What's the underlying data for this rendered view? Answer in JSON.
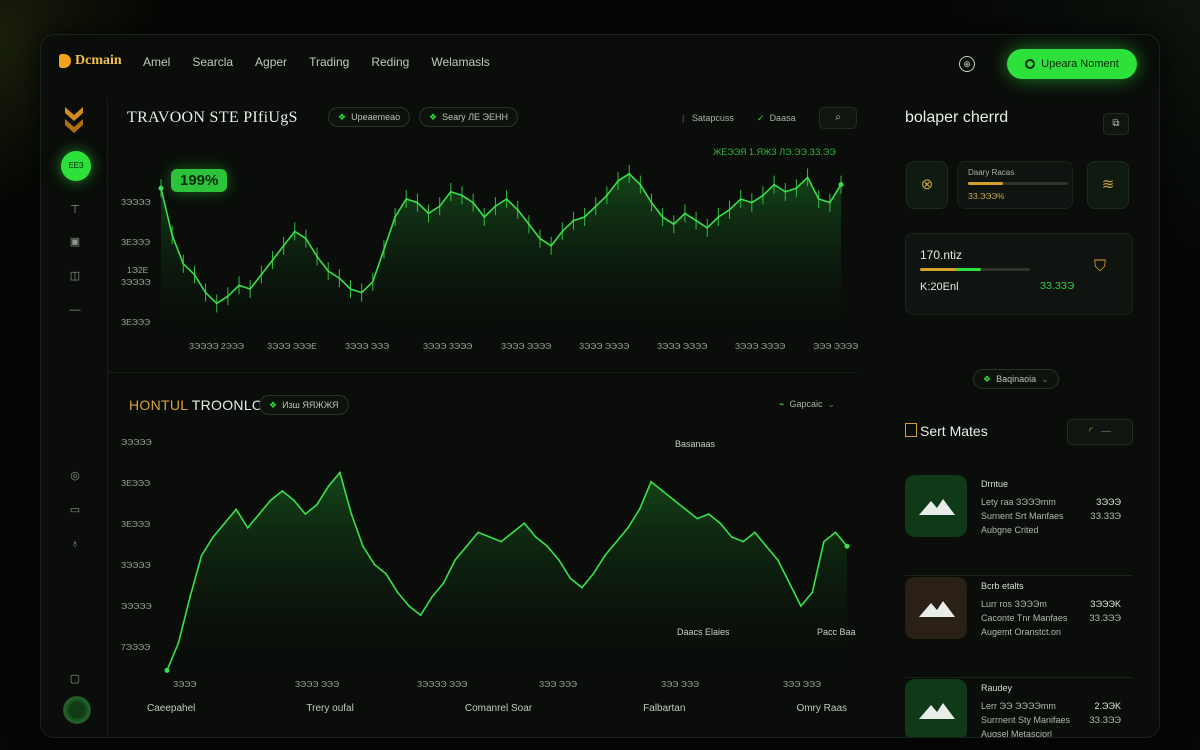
{
  "app": {
    "logo_text": "Dcmain",
    "nav": [
      "Amel",
      "Searcla",
      "Agper",
      "Trading",
      "Reding",
      "Welamasls"
    ],
    "upgrade_label": "Upeara Noment"
  },
  "sidebar": {
    "active_label": "ЕЕЗ"
  },
  "chart1": {
    "title": "TRAVOON STE PIfiUgS",
    "pill1": "Upeaemeao",
    "pill2": "Seary ЛЕ ЭЕНН",
    "filter1": "Satapcuss",
    "filter2": "Daasa",
    "ticker": "ЖЕЭЭЯ 1.ЯЖЗ ЛЭ.ЭЭ.ЗЗ.ЭЭ",
    "badge": "199%",
    "mid_label": "1Э2Е"
  },
  "chart2": {
    "title_a": "HONTUL",
    "title_b": " TROONLO",
    "pill": "Изш ЯЯЖЖЯ",
    "filter": "Gapcaic",
    "ann_top": "Basanaas",
    "ann_bottom1": "Daacs Elaies",
    "ann_bottom2": "Pacc Baa",
    "bottom_labels": [
      "Caeepahel",
      "Trery oufal",
      "Comanrel Soar",
      "Falbartan",
      "Omry Raas"
    ]
  },
  "chart_data": [
    {
      "type": "line",
      "title": "TRAVOON STE PIfiUgS",
      "y_tick_labels": [
        "ЗЭЭЭЭ",
        "ЗЕЭЭЭ",
        "ЗЭЭЭЭ",
        "ЗЕЭЭЭ"
      ],
      "x_tick_labels": [
        "ЗЭЭЭЭ 2ЭЭЭ",
        "ЗЭЭЭ ЭЭЭЕ",
        "ЗЭЭЭ ЭЭЭ",
        "ЗЭЭЭ ЗЭЭЭ",
        "ЗЭЭЭ ЭЭЭЭ",
        "ЗЭЭЭ ЭЭЭЭ",
        "ЗЭЭЭ ЭЭЭЭ",
        "ЗЭЭЭ ЭЭЭЭ",
        "ЭЭЭ ЭЭЭЭ"
      ],
      "ylim": [
        0,
        100
      ],
      "values": [
        86,
        60,
        44,
        38,
        28,
        22,
        26,
        32,
        30,
        38,
        46,
        54,
        62,
        58,
        48,
        40,
        36,
        30,
        28,
        34,
        52,
        70,
        80,
        78,
        72,
        76,
        84,
        82,
        78,
        70,
        76,
        80,
        74,
        66,
        58,
        54,
        62,
        68,
        70,
        76,
        82,
        90,
        94,
        88,
        78,
        70,
        66,
        72,
        68,
        64,
        70,
        74,
        80,
        78,
        82,
        88,
        84,
        86,
        92,
        80,
        78,
        88
      ]
    },
    {
      "type": "area",
      "title": "HONTUL TROONLO",
      "y_tick_labels": [
        "ЭЭЭЭЭ",
        "ЗЕЭЭЭ",
        "ЗЕЭЭЭ",
        "ЗЭЭЭЭ",
        "ЭЭЭЭЭ",
        "7ЭЭЭЭ"
      ],
      "x_tick_labels": [
        "ЗЭЭЭ",
        "ЗЭЭЭ ЭЭЭ",
        "ЗЭЭЭЭ ЭЭЭ",
        "ЗЭЭ ЭЭЭ",
        "ЗЭЭ ЭЭЭ",
        "ЗЭЭ ЭЭЭ"
      ],
      "ylim": [
        0,
        100
      ],
      "values": [
        2,
        14,
        34,
        52,
        60,
        66,
        72,
        64,
        70,
        76,
        80,
        76,
        70,
        74,
        82,
        88,
        70,
        56,
        48,
        44,
        36,
        30,
        26,
        34,
        40,
        50,
        56,
        62,
        60,
        58,
        62,
        66,
        60,
        56,
        50,
        42,
        38,
        44,
        52,
        58,
        64,
        72,
        84,
        80,
        76,
        72,
        68,
        70,
        66,
        60,
        58,
        62,
        56,
        50,
        40,
        30,
        36,
        58,
        62,
        56
      ]
    }
  ],
  "right": {
    "title": "bolaper cherrd",
    "card1_label": "Daary Racas",
    "card1_value": "ЗЗ.ЭЭЭ%",
    "card1_progress": 0.35,
    "card2_title": "170.ntiz",
    "card2_sub": "K:20Enl",
    "card2_value": "ЗЗ.ЗЗЭ",
    "card2_progress": 0.55,
    "dropdown": "Baqinaoia",
    "mates_title": "Sert Mates",
    "mates": [
      {
        "name": "Drntue",
        "l1": "Lety raa ЗЭЭЭmm",
        "l2": "Surnent Srt Manfaes",
        "l3": "Aubgne Crited",
        "v1": "ЗЭЭЭ",
        "v2": "ЗЗ.ЗЗЭ",
        "color": "#0f3a18"
      },
      {
        "name": "Bcrb etalts",
        "l1": "Lurr ros ЗЭЭЭm",
        "l2": "Caconte Tnr Manfaes",
        "l3": "Augemt Oranstct.on",
        "v1": "ЗЭЭЭK",
        "v2": "ЗЗ.ЗЭЭ",
        "color": "#2a2016"
      },
      {
        "name": "Raudey",
        "l1": "Lerr ЭЭ ЭЭЭЭmm",
        "l2": "Surrnent Sty Manifaes",
        "l3": "Augsel Metasciorl",
        "v1": "2.ЭЭK",
        "v2": "ЗЗ.ЗЭЭ",
        "color": "#0f3a18"
      }
    ]
  }
}
